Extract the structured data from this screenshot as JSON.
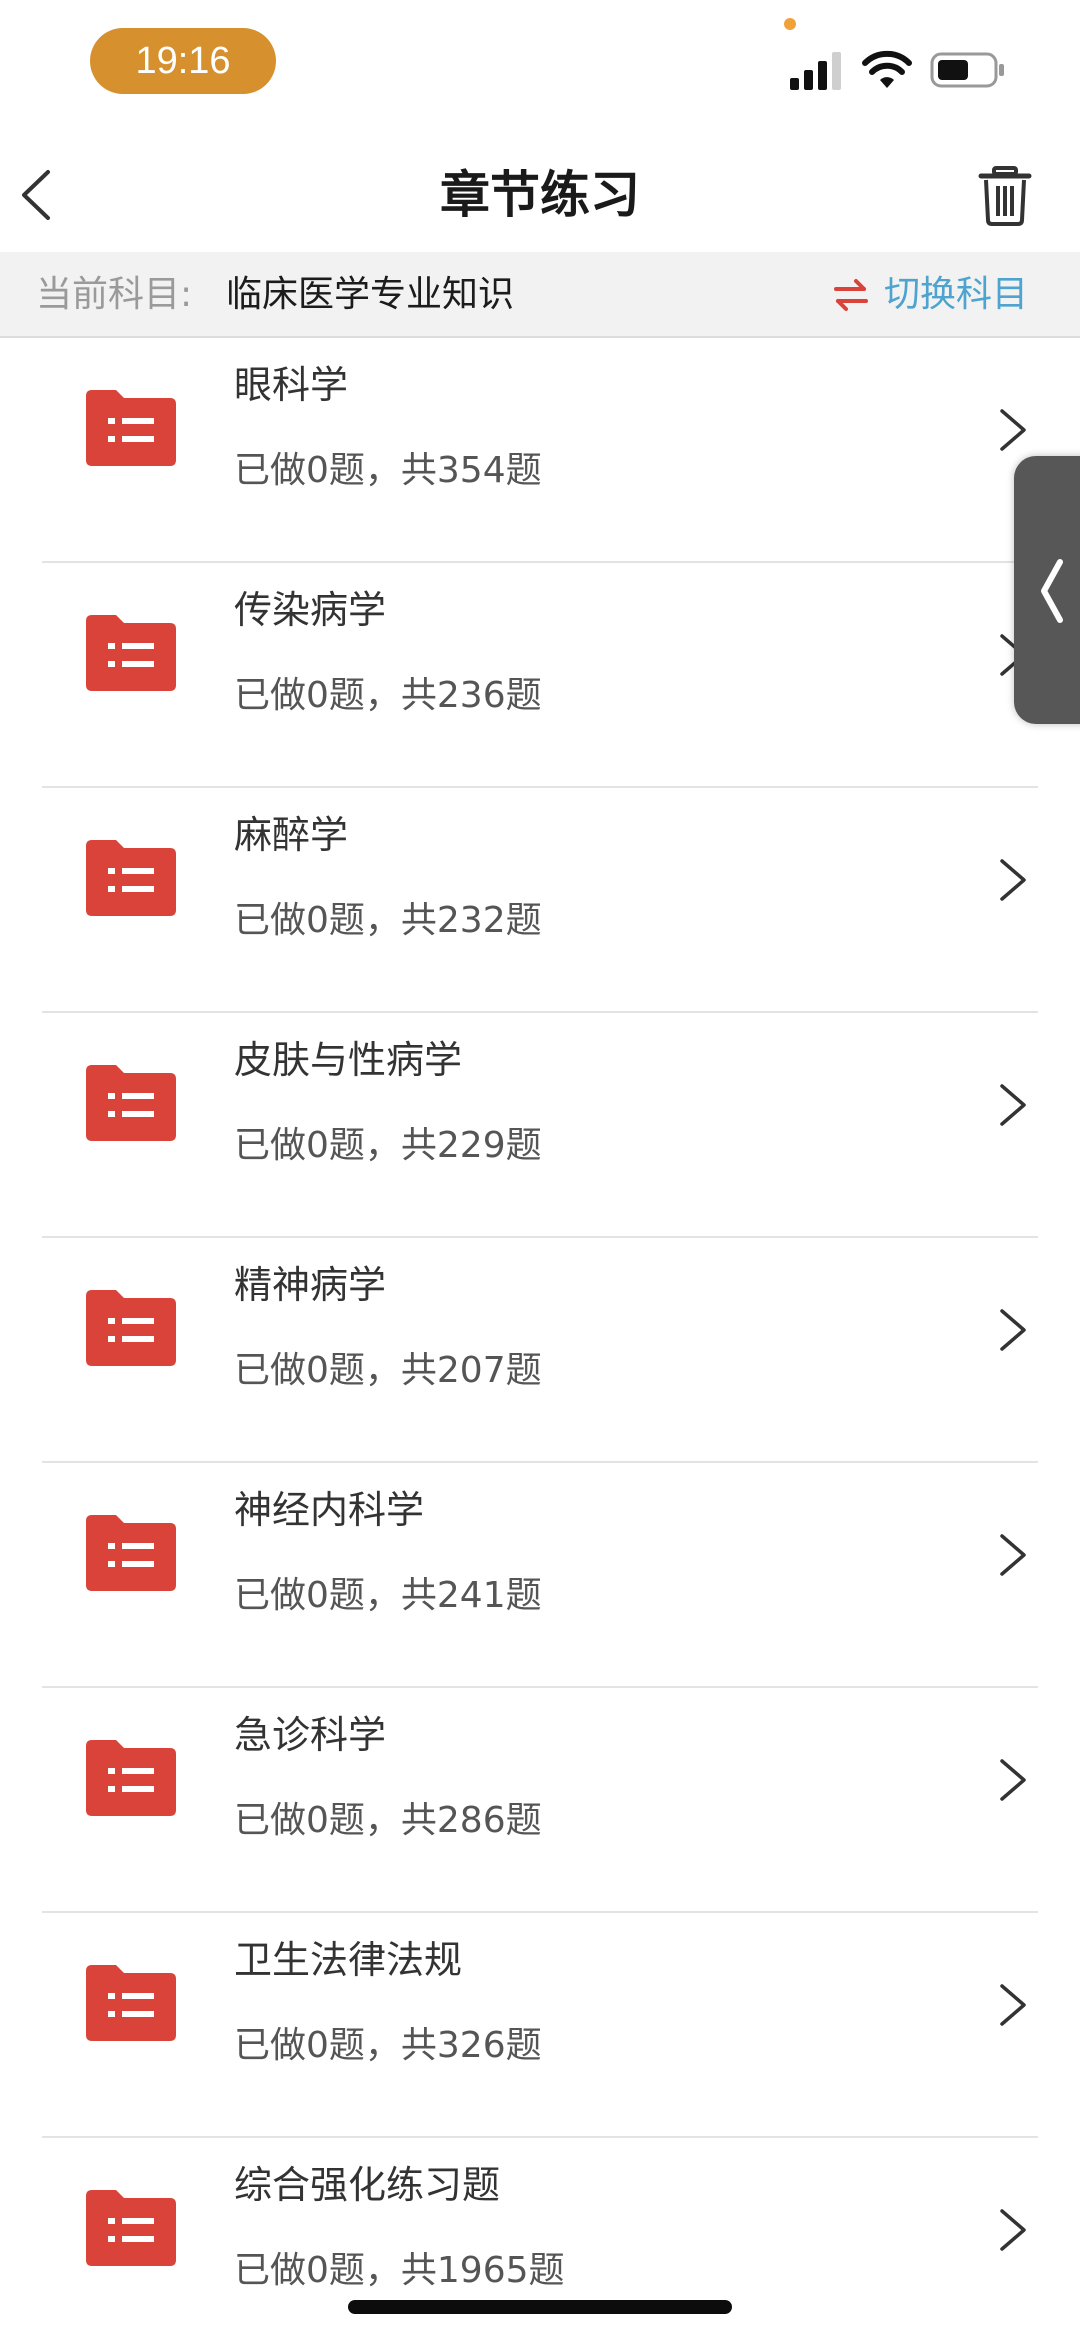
{
  "status_bar": {
    "time": "19:16"
  },
  "nav": {
    "title": "章节练习"
  },
  "subject_bar": {
    "label": "当前科目:",
    "value": "临床医学专业知识",
    "switch_label": "切换科目"
  },
  "colors": {
    "accent_red": "#d9433a",
    "accent_blue": "#4ea3cf",
    "time_pill": "#d6902e"
  },
  "chapters": [
    {
      "name": "眼科学",
      "progress": "已做0题，共354题"
    },
    {
      "name": "传染病学",
      "progress": "已做0题，共236题"
    },
    {
      "name": "麻醉学",
      "progress": "已做0题，共232题"
    },
    {
      "name": "皮肤与性病学",
      "progress": "已做0题，共229题"
    },
    {
      "name": "精神病学",
      "progress": "已做0题，共207题"
    },
    {
      "name": "神经内科学",
      "progress": "已做0题，共241题"
    },
    {
      "name": "急诊科学",
      "progress": "已做0题，共286题"
    },
    {
      "name": "卫生法律法规",
      "progress": "已做0题，共326题"
    },
    {
      "name": "综合强化练习题",
      "progress": "已做0题，共1965题"
    }
  ]
}
